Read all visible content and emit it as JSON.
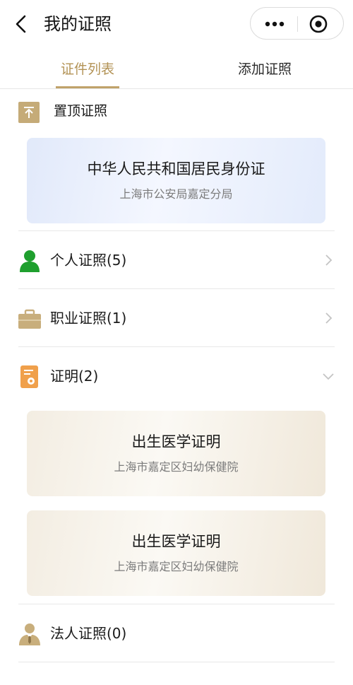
{
  "header": {
    "title": "我的证照",
    "back_icon": "back-arrow-icon",
    "more_icon": "more-dots-icon",
    "close_icon": "miniprogram-close-icon"
  },
  "tabs": [
    {
      "label": "证件列表",
      "active": true
    },
    {
      "label": "添加证照",
      "active": false
    }
  ],
  "pinned": {
    "label": "置顶证照",
    "icon": "pin-top-icon",
    "card": {
      "title": "中华人民共和国居民身份证",
      "issuer": "上海市公安局嘉定分局"
    }
  },
  "categories": [
    {
      "label": "个人证照(5)",
      "icon": "person-icon",
      "expanded": false
    },
    {
      "label": "职业证照(1)",
      "icon": "briefcase-icon",
      "expanded": false
    },
    {
      "label": "证明(2)",
      "icon": "certificate-icon",
      "expanded": true,
      "cards": [
        {
          "title": "出生医学证明",
          "issuer": "上海市嘉定区妇幼保健院"
        },
        {
          "title": "出生医学证明",
          "issuer": "上海市嘉定区妇幼保健院"
        }
      ]
    },
    {
      "label": "法人证照(0)",
      "icon": "legal-person-icon",
      "expanded": false
    }
  ],
  "colors": {
    "accent": "#b39356",
    "person_icon": "#1f9f2e",
    "briefcase_icon": "#c8ae7c",
    "certificate_icon": "#f0a04b",
    "pin_icon_bg": "#c5ab78"
  }
}
